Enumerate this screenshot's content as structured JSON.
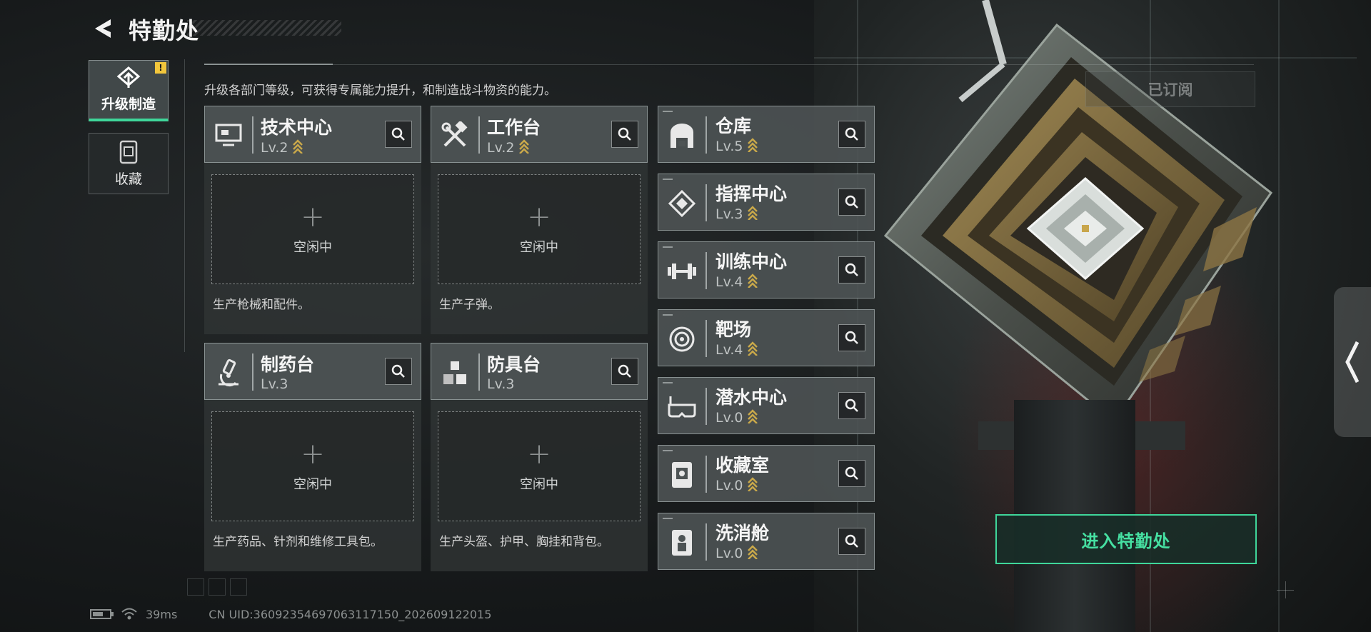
{
  "header": {
    "title": "特勤处",
    "description": "升级各部门等级，可获得专属能力提升，和制造战斗物资的能力。"
  },
  "nav": [
    {
      "label": "升级制造",
      "active": true,
      "alert": "!"
    },
    {
      "label": "收藏",
      "active": false
    }
  ],
  "cards": [
    {
      "name": "技术中心",
      "level": "Lv.2",
      "upgradable": true,
      "slot_status": "空闲中",
      "description": "生产枪械和配件。",
      "icon": "computer-icon"
    },
    {
      "name": "工作台",
      "level": "Lv.2",
      "upgradable": true,
      "slot_status": "空闲中",
      "description": "生产子弹。",
      "icon": "tools-icon"
    },
    {
      "name": "制药台",
      "level": "Lv.3",
      "upgradable": false,
      "slot_status": "空闲中",
      "description": "生产药品、针剂和维修工具包。",
      "icon": "microscope-icon"
    },
    {
      "name": "防具台",
      "level": "Lv.3",
      "upgradable": false,
      "slot_status": "空闲中",
      "description": "生产头盔、护甲、胸挂和背包。",
      "icon": "cubes-icon"
    }
  ],
  "side_list": [
    {
      "name": "仓库",
      "level": "Lv.5",
      "upgradable": true,
      "icon": "warehouse-icon"
    },
    {
      "name": "指挥中心",
      "level": "Lv.3",
      "upgradable": true,
      "icon": "command-icon"
    },
    {
      "name": "训练中心",
      "level": "Lv.4",
      "upgradable": true,
      "icon": "dumbbell-icon"
    },
    {
      "name": "靶场",
      "level": "Lv.4",
      "upgradable": true,
      "icon": "target-icon"
    },
    {
      "name": "潜水中心",
      "level": "Lv.0",
      "upgradable": true,
      "icon": "diving-mask-icon"
    },
    {
      "name": "收藏室",
      "level": "Lv.0",
      "upgradable": true,
      "icon": "display-case-icon"
    },
    {
      "name": "洗消舱",
      "level": "Lv.0",
      "upgradable": true,
      "icon": "decon-pod-icon"
    }
  ],
  "subscribed_label": "已订阅",
  "enter_button": "进入特勤处",
  "status": {
    "ping": "39ms",
    "uid": "CN UID:36092354697063117150_202609122015"
  },
  "colors": {
    "accent": "#3fd69a",
    "upgrade_chevron": "#c9a84a",
    "alert": "#f2c63c"
  }
}
